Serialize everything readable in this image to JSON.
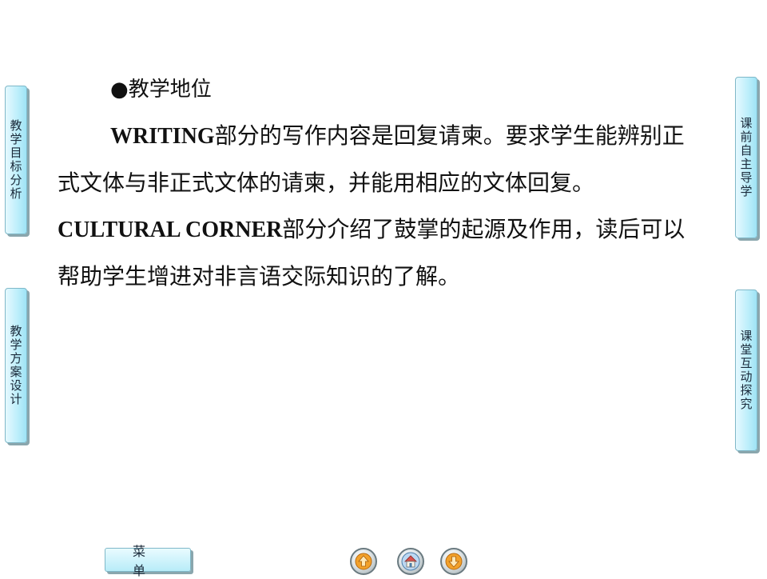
{
  "left_tabs": [
    {
      "label": "教学目标分析"
    },
    {
      "label": "教学方案设计"
    }
  ],
  "right_tabs": [
    {
      "label": "课前自主导学"
    },
    {
      "label": "课堂互动探究"
    }
  ],
  "content": {
    "heading_bullet": "●",
    "heading": "教学地位",
    "p1_bold": "WRITING",
    "p1_text": "部分的写作内容是回复请柬。要求学生能辨别正式文体与非正式文体的请柬，并能用相应的文体回复。",
    "p1_bold2": "CULTURAL CORNER",
    "p1_text2": "部分介绍了鼓掌的起源及作用，读后可以帮助学生增进对非言语交际知识的了解。"
  },
  "footer": {
    "menu_label": "菜单"
  },
  "icons": {
    "prev": "arrow-up-icon",
    "home": "home-icon",
    "next": "arrow-down-icon",
    "prev_color": "#f2a12b",
    "next_color": "#f2a12b",
    "home_color": "#6aa0d8"
  }
}
